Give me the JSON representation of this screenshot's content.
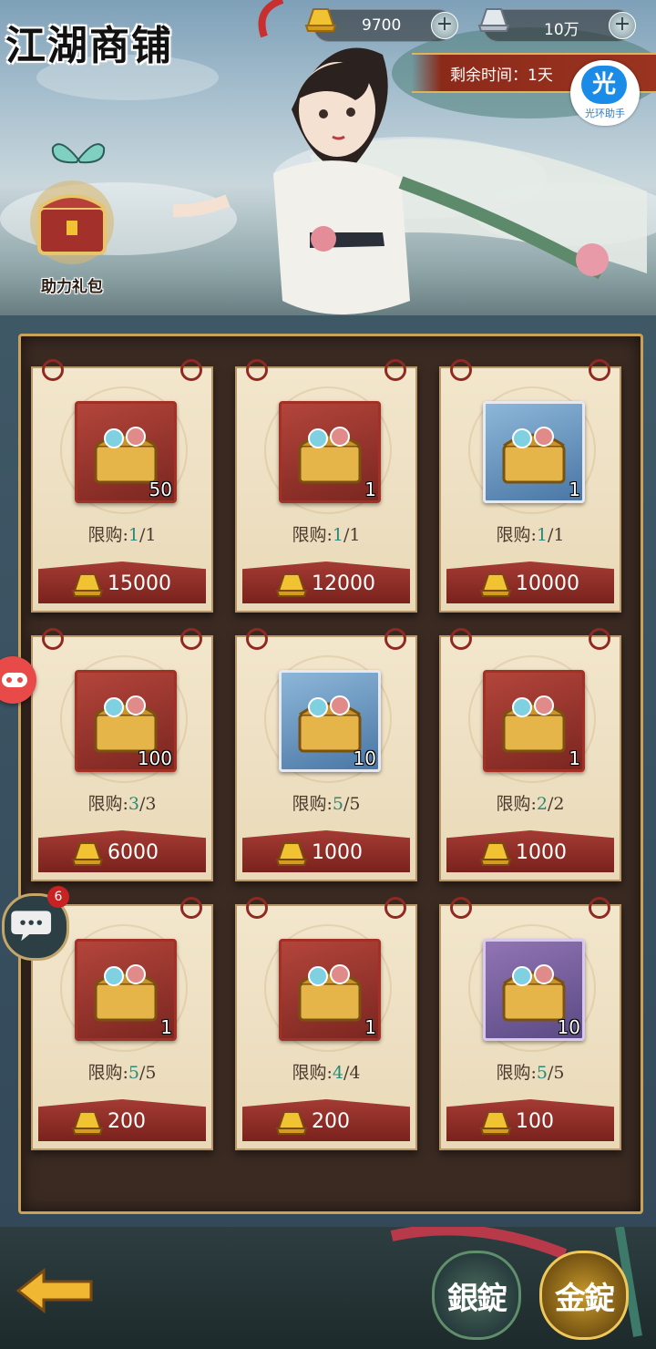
{
  "header": {
    "title": "江湖商铺",
    "currency_gold": "9700",
    "currency_silver": "10万",
    "timer_text": "剩余时间：1天",
    "assist_glyph": "光",
    "assist_label": "光环助手",
    "gift_label": "助力礼包",
    "add_icon": "plus-icon"
  },
  "shop": {
    "limit_label": "限购:",
    "items": [
      {
        "qty": "50",
        "limit_cur": "1",
        "limit_max": "1",
        "price": "15000",
        "bg": "red"
      },
      {
        "qty": "1",
        "limit_cur": "1",
        "limit_max": "1",
        "price": "12000",
        "bg": "red"
      },
      {
        "qty": "1",
        "limit_cur": "1",
        "limit_max": "1",
        "price": "10000",
        "bg": "blue"
      },
      {
        "qty": "100",
        "limit_cur": "3",
        "limit_max": "3",
        "price": "6000",
        "bg": "red"
      },
      {
        "qty": "10",
        "limit_cur": "5",
        "limit_max": "5",
        "price": "1000",
        "bg": "blue"
      },
      {
        "qty": "1",
        "limit_cur": "2",
        "limit_max": "2",
        "price": "1000",
        "bg": "red"
      },
      {
        "qty": "1",
        "limit_cur": "5",
        "limit_max": "5",
        "price": "200",
        "bg": "red"
      },
      {
        "qty": "1",
        "limit_cur": "4",
        "limit_max": "4",
        "price": "200",
        "bg": "red"
      },
      {
        "qty": "10",
        "limit_cur": "5",
        "limit_max": "5",
        "price": "100",
        "bg": "purple"
      }
    ]
  },
  "side": {
    "chat_badge": "6"
  },
  "bottom": {
    "tab_silver": "銀錠",
    "tab_gold": "金錠"
  },
  "colors": {
    "accent_red": "#8c2a1a",
    "frame_gold": "#c9a257",
    "limit_teal": "#2a8a7a"
  }
}
